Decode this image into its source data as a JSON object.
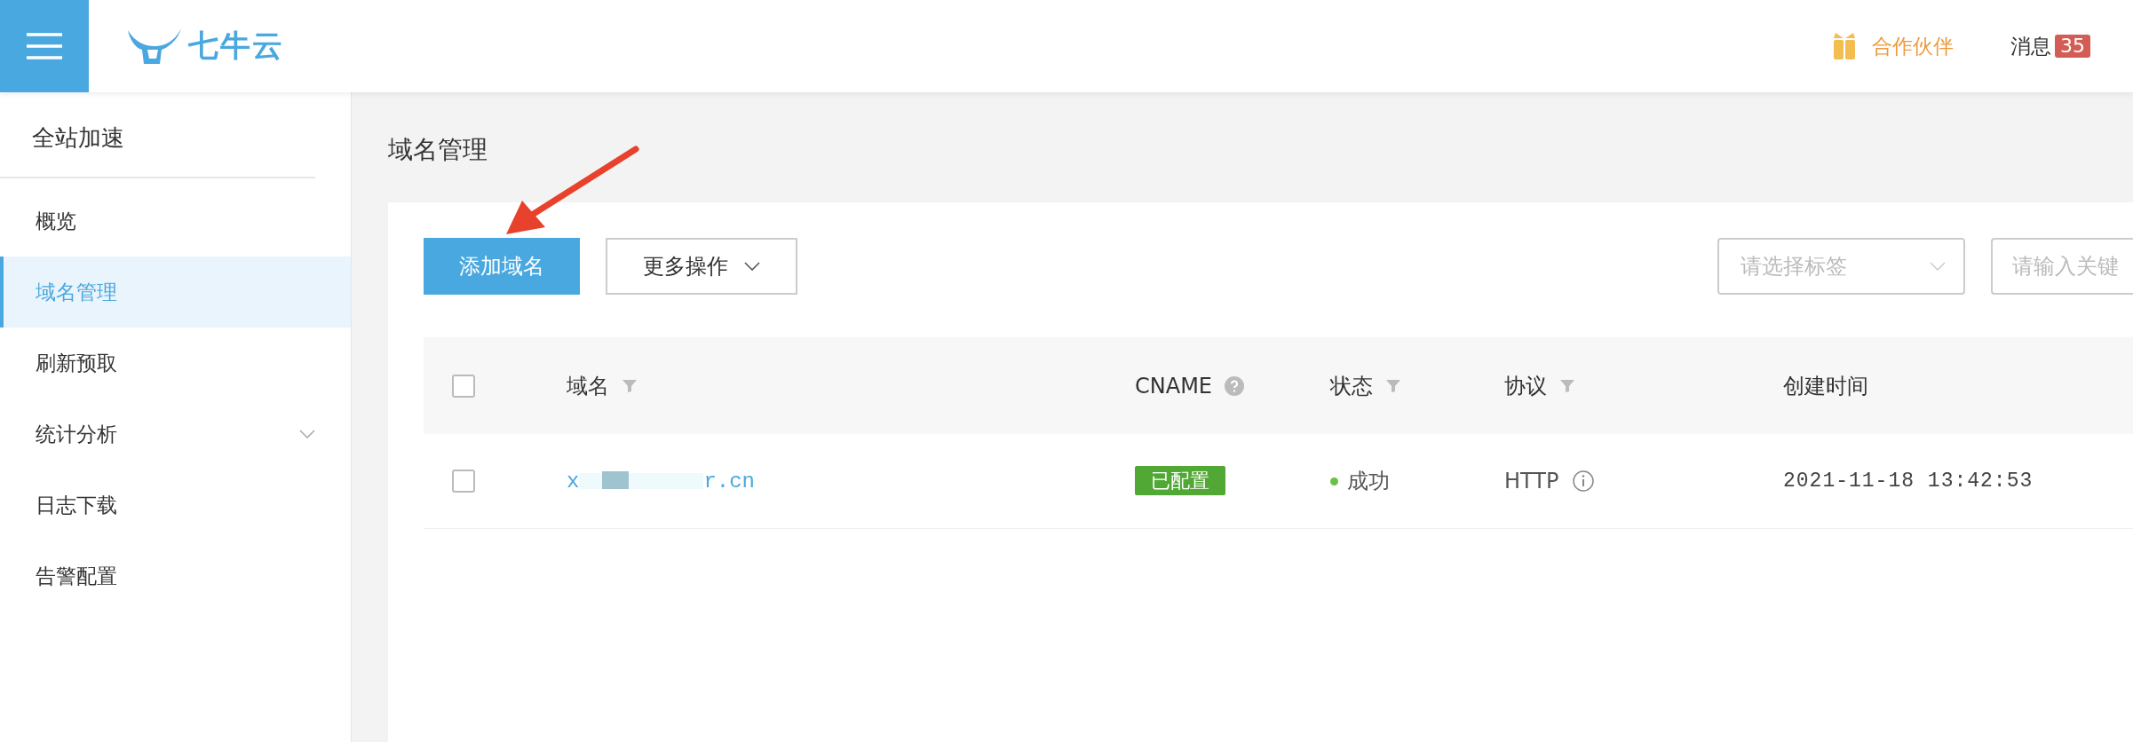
{
  "header": {
    "logo_text": "七牛云",
    "partner_link": "合作伙伴",
    "messages": {
      "label": "消息",
      "count": "35"
    }
  },
  "sidebar": {
    "title": "全站加速",
    "items": [
      {
        "label": "概览",
        "selected": false,
        "expandable": false
      },
      {
        "label": "域名管理",
        "selected": true,
        "expandable": false
      },
      {
        "label": "刷新预取",
        "selected": false,
        "expandable": false
      },
      {
        "label": "统计分析",
        "selected": false,
        "expandable": true
      },
      {
        "label": "日志下载",
        "selected": false,
        "expandable": false
      },
      {
        "label": "告警配置",
        "selected": false,
        "expandable": false
      }
    ]
  },
  "page_title": "域名管理",
  "toolbar": {
    "primary_button": "添加域名",
    "more_button": "更多操作",
    "tag_select": {
      "placeholder": "请选择标签"
    },
    "search": {
      "placeholder": "请输入关键"
    }
  },
  "table": {
    "columns": [
      {
        "label": "域名",
        "kind": "filter"
      },
      {
        "label": "CNAME",
        "kind": "help"
      },
      {
        "label": "状态",
        "kind": "filter"
      },
      {
        "label": "协议",
        "kind": "filter"
      },
      {
        "label": "创建时间",
        "kind": "plain"
      }
    ],
    "select_all_checked": false,
    "rows": [
      {
        "checked": false,
        "domain_start": "x",
        "domain_end": "r.cn",
        "cname": "已配置",
        "status": "成功",
        "color": "#6cc04a",
        "protocol": "HTTP",
        "created": "2021-11-18 13:42:53"
      }
    ]
  }
}
